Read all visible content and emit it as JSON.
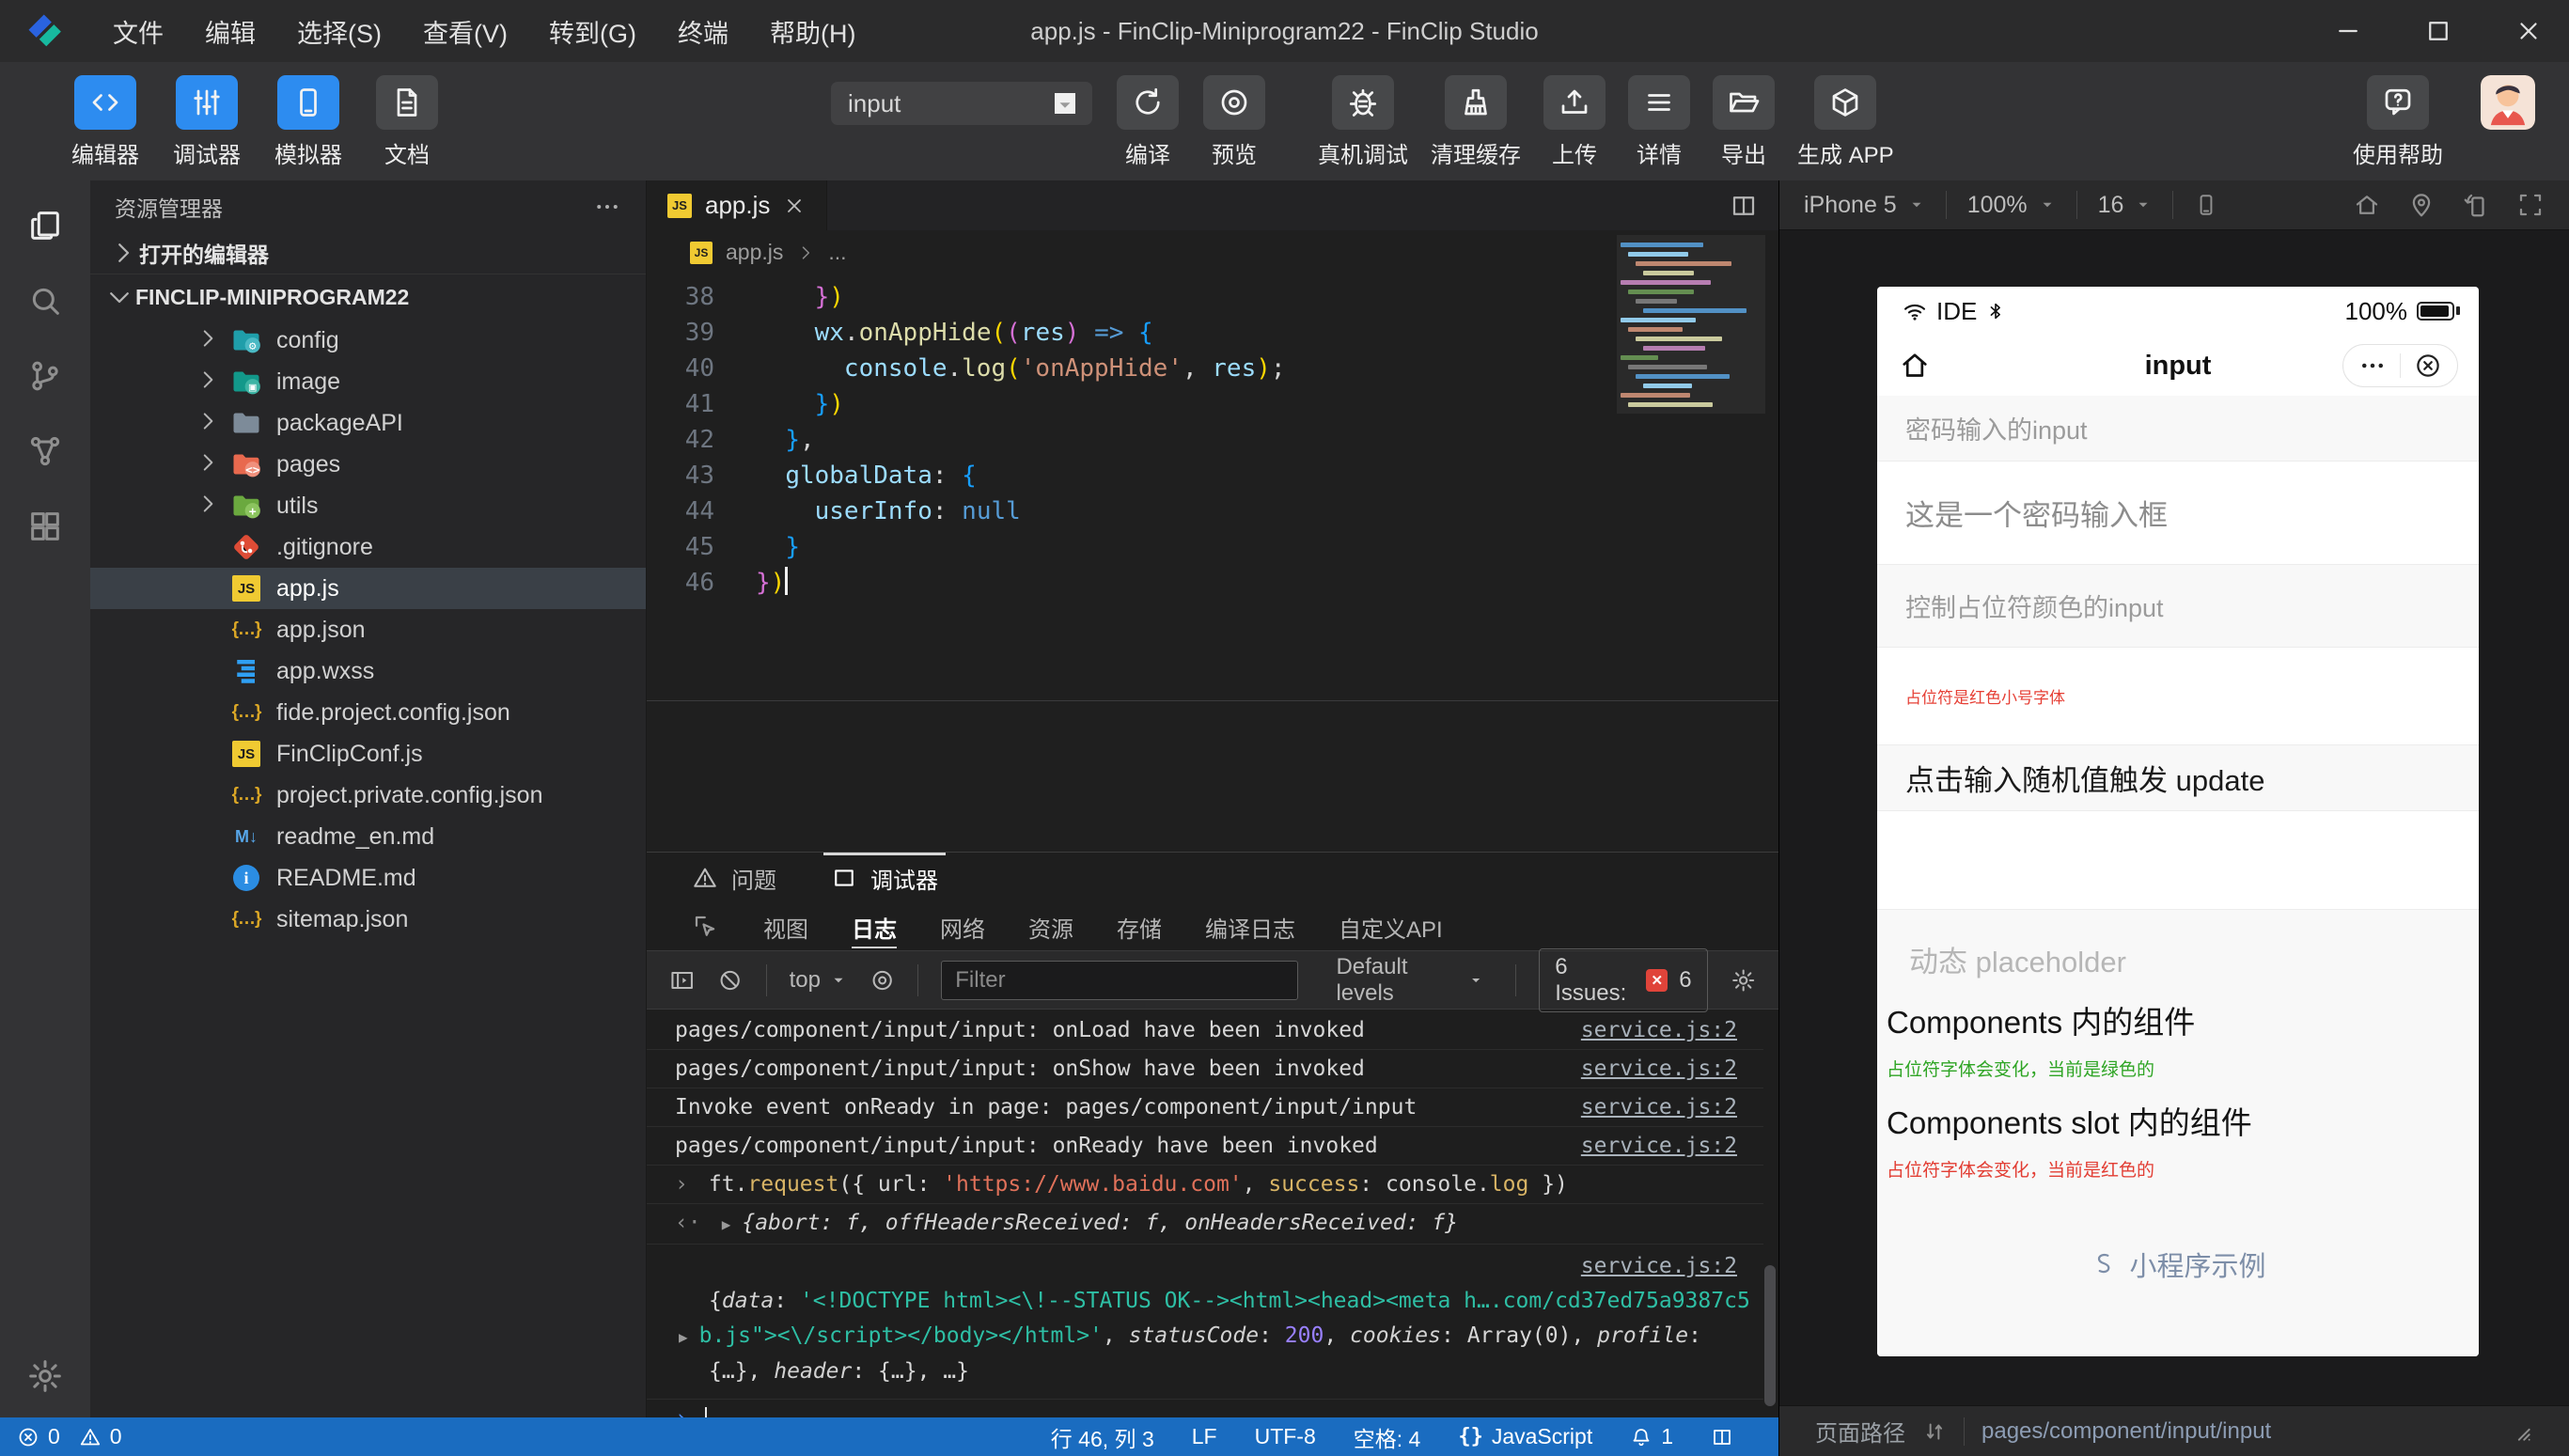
{
  "window": {
    "title": "app.js - FinClip-Miniprogram22 - FinClip Studio",
    "menus": [
      "文件",
      "编辑",
      "选择(S)",
      "查看(V)",
      "转到(G)",
      "终端",
      "帮助(H)"
    ]
  },
  "toolbar": {
    "modes": [
      {
        "name": "editor-mode",
        "label": "编辑器",
        "icon": "code",
        "active": true
      },
      {
        "name": "debugger-mode",
        "label": "调试器",
        "icon": "sliders",
        "active": true
      },
      {
        "name": "simulator-mode",
        "label": "模拟器",
        "icon": "phone",
        "active": true
      },
      {
        "name": "docs",
        "label": "文档",
        "icon": "doc",
        "active": false
      }
    ],
    "compile_target": "input",
    "center_actions": [
      {
        "name": "compile",
        "label": "编译",
        "icon": "refresh"
      },
      {
        "name": "preview",
        "label": "预览",
        "icon": "preview"
      }
    ],
    "right_actions": [
      {
        "name": "remote-debug",
        "label": "真机调试",
        "icon": "bug"
      },
      {
        "name": "clear-cache",
        "label": "清理缓存",
        "icon": "broom"
      },
      {
        "name": "upload",
        "label": "上传",
        "icon": "upload"
      },
      {
        "name": "details",
        "label": "详情",
        "icon": "list"
      },
      {
        "name": "export",
        "label": "导出",
        "icon": "folderout"
      },
      {
        "name": "generate-app",
        "label": "生成 APP",
        "icon": "appbox"
      }
    ],
    "help_label": "使用帮助"
  },
  "activity_bar": [
    {
      "name": "explorer",
      "icon": "files",
      "active": true
    },
    {
      "name": "search",
      "icon": "search",
      "active": false
    },
    {
      "name": "source-control",
      "icon": "branch",
      "active": false
    },
    {
      "name": "deploy",
      "icon": "deploy",
      "active": false
    },
    {
      "name": "extensions",
      "icon": "grid",
      "active": false
    }
  ],
  "explorer": {
    "title": "资源管理器",
    "open_editors": "打开的编辑器",
    "project": "FINCLIP-MINIPROGRAM22",
    "items": [
      {
        "name": "config",
        "type": "folder",
        "icon": "config"
      },
      {
        "name": "image",
        "type": "folder",
        "icon": "image"
      },
      {
        "name": "packageAPI",
        "type": "folder",
        "icon": "plain"
      },
      {
        "name": "pages",
        "type": "folder",
        "icon": "pages"
      },
      {
        "name": "utils",
        "type": "folder",
        "icon": "utils"
      },
      {
        "name": ".gitignore",
        "type": "file",
        "icon": "git"
      },
      {
        "name": "app.js",
        "type": "file",
        "icon": "js",
        "selected": true
      },
      {
        "name": "app.json",
        "type": "file",
        "icon": "json"
      },
      {
        "name": "app.wxss",
        "type": "file",
        "icon": "wxss"
      },
      {
        "name": "fide.project.config.json",
        "type": "file",
        "icon": "json"
      },
      {
        "name": "FinClipConf.js",
        "type": "file",
        "icon": "js"
      },
      {
        "name": "project.private.config.json",
        "type": "file",
        "icon": "json"
      },
      {
        "name": "readme_en.md",
        "type": "file",
        "icon": "md"
      },
      {
        "name": "README.md",
        "type": "file",
        "icon": "info"
      },
      {
        "name": "sitemap.json",
        "type": "file",
        "icon": "json"
      }
    ]
  },
  "editor": {
    "tab": "app.js",
    "breadcrumb_file": "app.js",
    "breadcrumb_tail": "...",
    "code": [
      {
        "n": 38,
        "segs": [
          [
            "    ",
            ""
          ],
          [
            "}",
            "b2"
          ],
          [
            ")",
            "b1"
          ]
        ]
      },
      {
        "n": 39,
        "segs": [
          [
            "    ",
            ""
          ],
          [
            "wx",
            "v"
          ],
          [
            ".",
            ""
          ],
          [
            "onAppHide",
            "f"
          ],
          [
            "(",
            "b1"
          ],
          [
            "(",
            "b2"
          ],
          [
            "res",
            "v"
          ],
          [
            ")",
            "b2"
          ],
          [
            " ",
            ""
          ],
          [
            "=>",
            "k"
          ],
          [
            " ",
            ""
          ],
          [
            "{",
            "b3"
          ]
        ]
      },
      {
        "n": 40,
        "segs": [
          [
            "      ",
            ""
          ],
          [
            "console",
            "v"
          ],
          [
            ".",
            ""
          ],
          [
            "log",
            "f"
          ],
          [
            "(",
            "b1"
          ],
          [
            "'onAppHide'",
            "s"
          ],
          [
            ", ",
            ""
          ],
          [
            "res",
            "v"
          ],
          [
            ")",
            "b1"
          ],
          [
            ";",
            ""
          ]
        ]
      },
      {
        "n": 41,
        "segs": [
          [
            "    ",
            ""
          ],
          [
            "}",
            "b3"
          ],
          [
            ")",
            "b1"
          ]
        ]
      },
      {
        "n": 42,
        "segs": [
          [
            "  ",
            ""
          ],
          [
            "}",
            "b3"
          ],
          [
            ",",
            ""
          ]
        ]
      },
      {
        "n": 43,
        "segs": [
          [
            "  ",
            ""
          ],
          [
            "globalData",
            "v"
          ],
          [
            ": ",
            ""
          ],
          [
            "{",
            "b3"
          ]
        ]
      },
      {
        "n": 44,
        "segs": [
          [
            "    ",
            ""
          ],
          [
            "userInfo",
            "v"
          ],
          [
            ": ",
            ""
          ],
          [
            "null",
            "k"
          ]
        ]
      },
      {
        "n": 45,
        "segs": [
          [
            "  ",
            ""
          ],
          [
            "}",
            "b3"
          ]
        ]
      },
      {
        "n": 46,
        "segs": [
          [
            "}",
            "b2"
          ],
          [
            ")",
            "b1"
          ]
        ],
        "cursor": true
      }
    ]
  },
  "panel": {
    "tabs": [
      {
        "name": "problems",
        "label": "问题",
        "icon": "warning",
        "active": false
      },
      {
        "name": "debugger",
        "label": "调试器",
        "icon": "panelbox",
        "active": true
      }
    ],
    "subtabs": [
      "视图",
      "日志",
      "网络",
      "资源",
      "存储",
      "编译日志",
      "自定义API"
    ],
    "active_subtab": "日志",
    "toolbar": {
      "context": "top",
      "filter_placeholder": "Filter",
      "levels": "Default levels",
      "issues_label": "6 Issues:",
      "issues_count": "6"
    },
    "entries": [
      {
        "kind": "log",
        "text": "pages/component/input/input: onLoad have been invoked",
        "link": "service.js:2"
      },
      {
        "kind": "log",
        "text": "pages/component/input/input: onShow have been invoked",
        "link": "service.js:2"
      },
      {
        "kind": "log",
        "text": "Invoke event onReady in page: pages/component/input/input",
        "link": "service.js:2"
      },
      {
        "kind": "log",
        "text": "pages/component/input/input: onReady have been invoked",
        "link": "service.js:2"
      },
      {
        "kind": "cmd",
        "segs": [
          [
            "ft",
            ""
          ],
          [
            ".",
            ""
          ],
          [
            "request",
            "f"
          ],
          [
            "({ ",
            ""
          ],
          [
            "url",
            ""
          ],
          [
            ": ",
            ""
          ],
          [
            "'https://www.baidu.com'",
            "s"
          ],
          [
            ", ",
            ""
          ],
          [
            "success",
            "f"
          ],
          [
            ": ",
            ""
          ],
          [
            "console",
            ""
          ],
          [
            ".",
            ""
          ],
          [
            "log",
            "f"
          ],
          [
            " })",
            ""
          ]
        ]
      },
      {
        "kind": "ret",
        "segs": [
          [
            "{",
            ""
          ],
          [
            "abort",
            "pv"
          ],
          [
            ": ",
            ""
          ],
          [
            "f",
            "fi"
          ],
          [
            ", ",
            ""
          ],
          [
            "offHeadersReceived",
            "pv"
          ],
          [
            ": ",
            ""
          ],
          [
            "f",
            "fi"
          ],
          [
            ", ",
            ""
          ],
          [
            "onHeadersReceived",
            "pv"
          ],
          [
            ": ",
            ""
          ],
          [
            "f",
            "fi"
          ],
          [
            "}",
            ""
          ]
        ]
      },
      {
        "kind": "obj",
        "link": "service.js:2",
        "lines": [
          [
            [
              "{",
              ""
            ],
            [
              "data",
              "pv"
            ],
            [
              ": ",
              ""
            ],
            [
              "'<!DOCTYPE html><\\!--STATUS OK--><html><head><meta h….com/cd37ed75a9387c5",
              "ts"
            ]
          ],
          [
            [
              "b.js\"><\\/script></body></html>'",
              "ts"
            ],
            [
              ", ",
              ""
            ],
            [
              "statusCode",
              "pv"
            ],
            [
              ": ",
              ""
            ],
            [
              "200",
              "num"
            ],
            [
              ", ",
              ""
            ],
            [
              "cookies",
              "pv"
            ],
            [
              ": ",
              ""
            ],
            [
              "Array(0)",
              ""
            ],
            [
              ", ",
              ""
            ],
            [
              "profile",
              "pv"
            ],
            [
              ": ",
              ""
            ]
          ],
          [
            [
              "{…}",
              ""
            ],
            [
              ", ",
              ""
            ],
            [
              "header",
              "pv"
            ],
            [
              ": ",
              ""
            ],
            [
              "{…}",
              ""
            ],
            [
              ", …}",
              ""
            ]
          ]
        ]
      },
      {
        "kind": "prompt"
      }
    ]
  },
  "statusbar": {
    "errors": "0",
    "warnings": "0",
    "cursor": "行 46, 列 3",
    "eol": "LF",
    "encoding": "UTF-8",
    "indent": "空格: 4",
    "language": "JavaScript",
    "notifications": "1"
  },
  "simulator": {
    "device": "iPhone 5",
    "zoom": "100%",
    "fontsize": "16",
    "phone": {
      "carrier": "IDE",
      "battery": "100%",
      "nav_title": "input",
      "rows": [
        {
          "style": "header",
          "text": "密码输入的input"
        },
        {
          "style": "input-lg",
          "text": "这是一个密码输入框"
        },
        {
          "style": "header tall",
          "text": "控制占位符颜色的input"
        },
        {
          "style": "input-sm red-text",
          "text": "占位符是红色小号字体"
        },
        {
          "style": "header dark-text",
          "text": "点击输入随机值触发 update"
        },
        {
          "style": "input-empty",
          "text": ""
        }
      ],
      "section": {
        "placeholder": "动态 placeholder",
        "heading1": "Components 内的组件",
        "green_note": "占位符字体会变化，当前是绿色的",
        "heading2": "Components slot 内的组件",
        "red_note": "占位符字体会变化，当前是红色的"
      },
      "footer_link": "小程序示例"
    },
    "path_label": "页面路径",
    "path": "pages/component/input/input"
  },
  "colors": {
    "accent_blue": "#2d8cf0",
    "statusbar_blue": "#1a6cc0",
    "issue_red": "#e0443a",
    "note_green": "#2fa525",
    "note_red": "#e23d33",
    "string_teal": "#2ebfa5",
    "number_purple": "#9980ff",
    "js_yellow": "#f0ca32"
  }
}
